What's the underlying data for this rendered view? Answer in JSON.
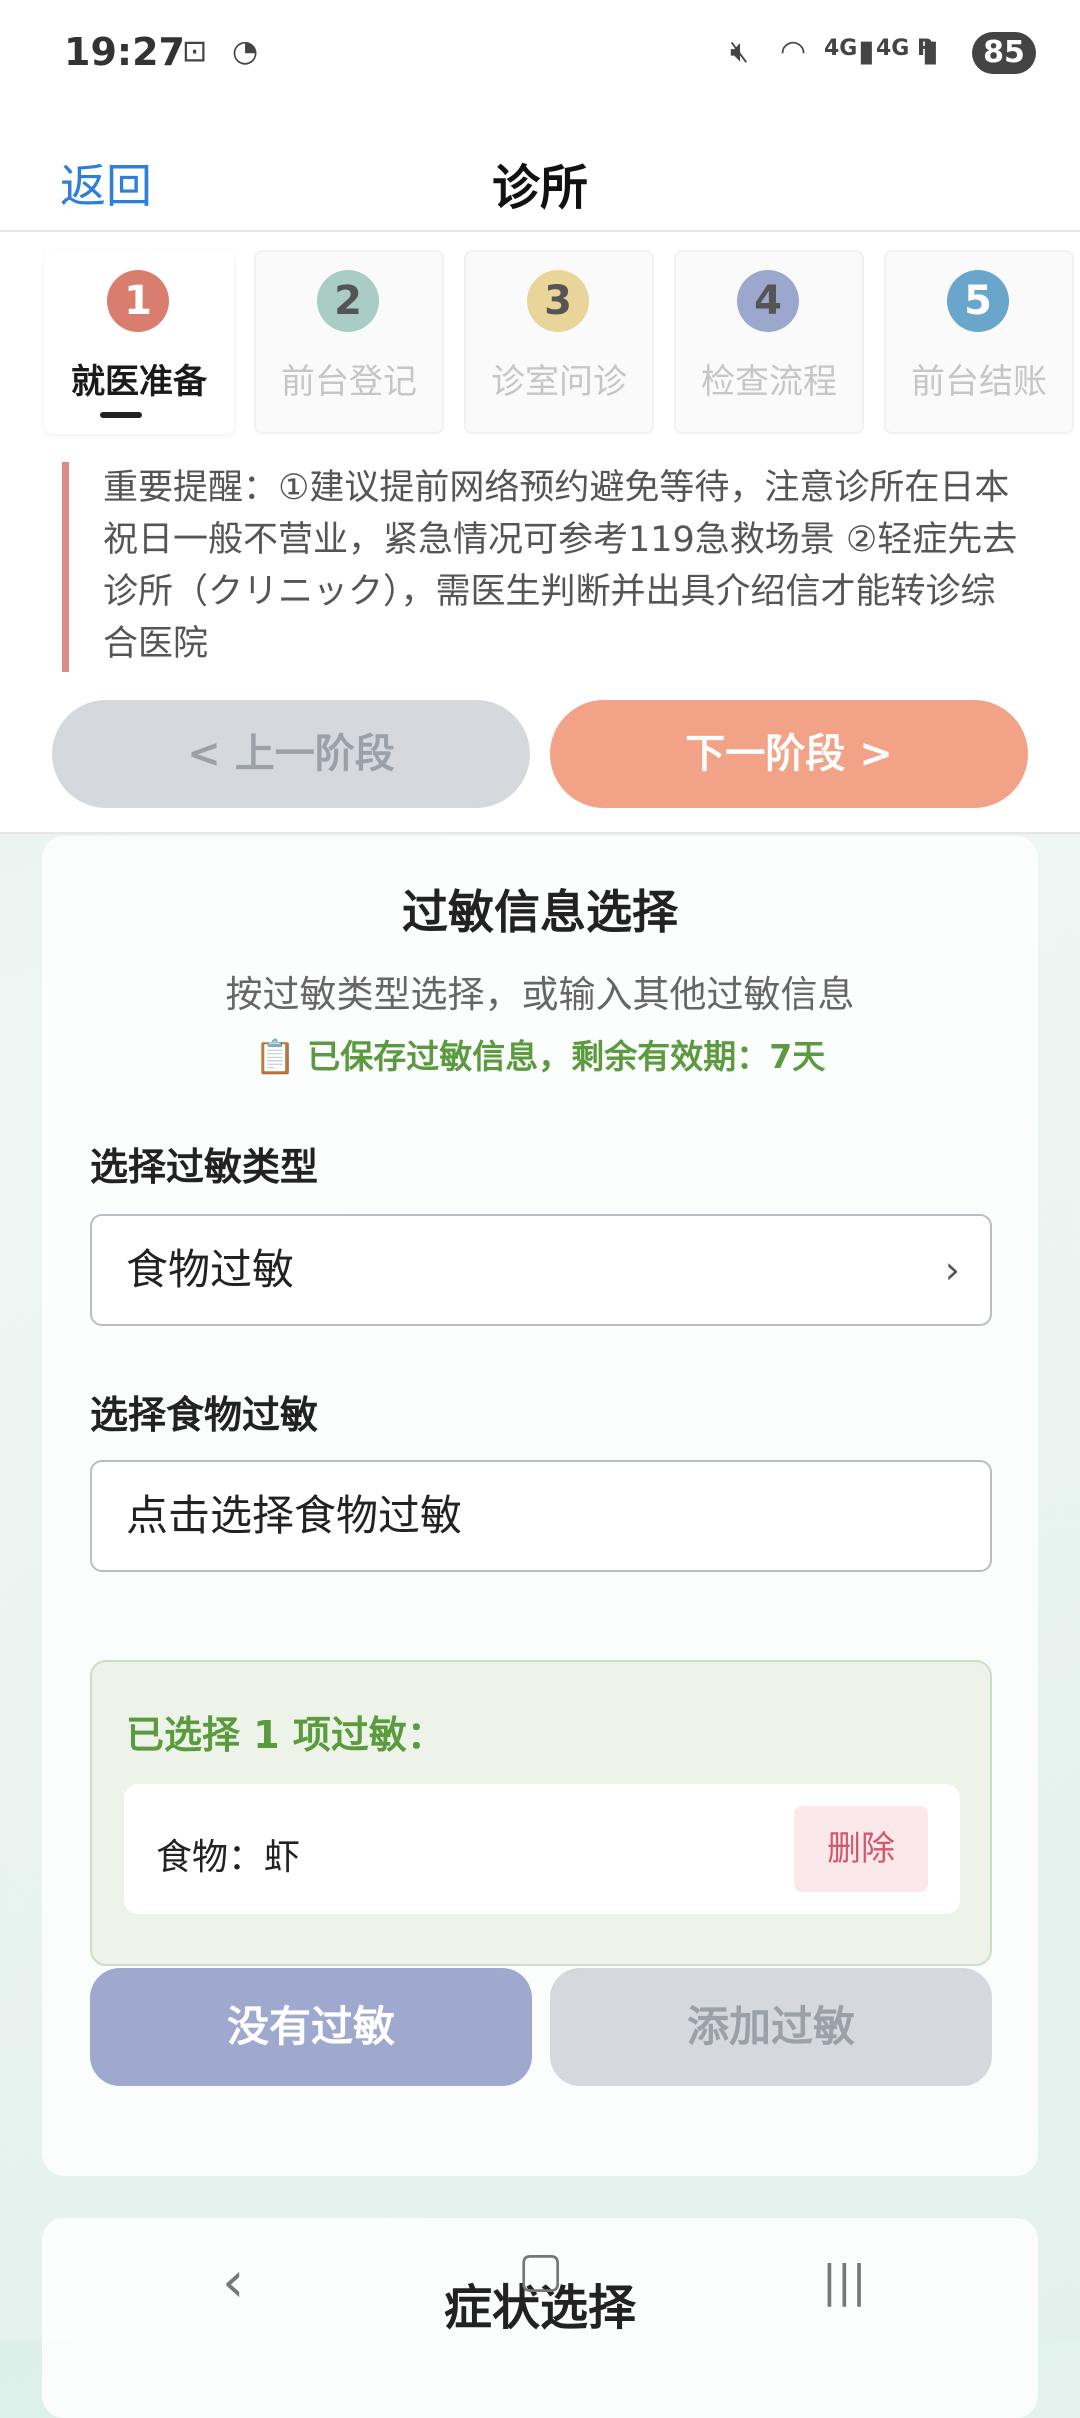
{
  "status": {
    "time": "19:27",
    "network1": "4G",
    "network2": "4G R",
    "battery": "85"
  },
  "nav": {
    "back_label": "返回",
    "title": "诊所"
  },
  "steps": [
    {
      "number": "1",
      "label": "就医准备",
      "color": "#d97d6e"
    },
    {
      "number": "2",
      "label": "前台登记",
      "color": "#a9cdc4"
    },
    {
      "number": "3",
      "label": "诊室问诊",
      "color": "#e9d59a"
    },
    {
      "number": "4",
      "label": "检查流程",
      "color": "#9ba7cc"
    },
    {
      "number": "5",
      "label": "前台结账",
      "color": "#6aa6cc"
    }
  ],
  "notice": "重要提醒：①建议提前网络预约避免等待，注意诊所在日本祝日一般不营业，紧急情况可参考119急救场景 ②轻症先去诊所（クリニック），需医生判断并出具介绍信才能转诊综合医院",
  "phase": {
    "prev_label": "< 上一阶段",
    "next_label": "下一阶段 >"
  },
  "allergy": {
    "title": "过敏信息选择",
    "subtitle": "按过敏类型选择，或输入其他过敏信息",
    "saved_note": "📋 已保存过敏信息，剩余有效期：7天",
    "type_label": "选择过敏类型",
    "type_value": "食物过敏",
    "food_label": "选择食物过敏",
    "food_placeholder": "点击选择食物过敏",
    "selected_title": "已选择 1 项过敏：",
    "items": [
      {
        "text": "食物：虾",
        "delete_label": "删除"
      }
    ],
    "no_allergy_label": "没有过敏",
    "add_allergy_label": "添加过敏"
  },
  "symptom": {
    "title": "症状选择"
  }
}
